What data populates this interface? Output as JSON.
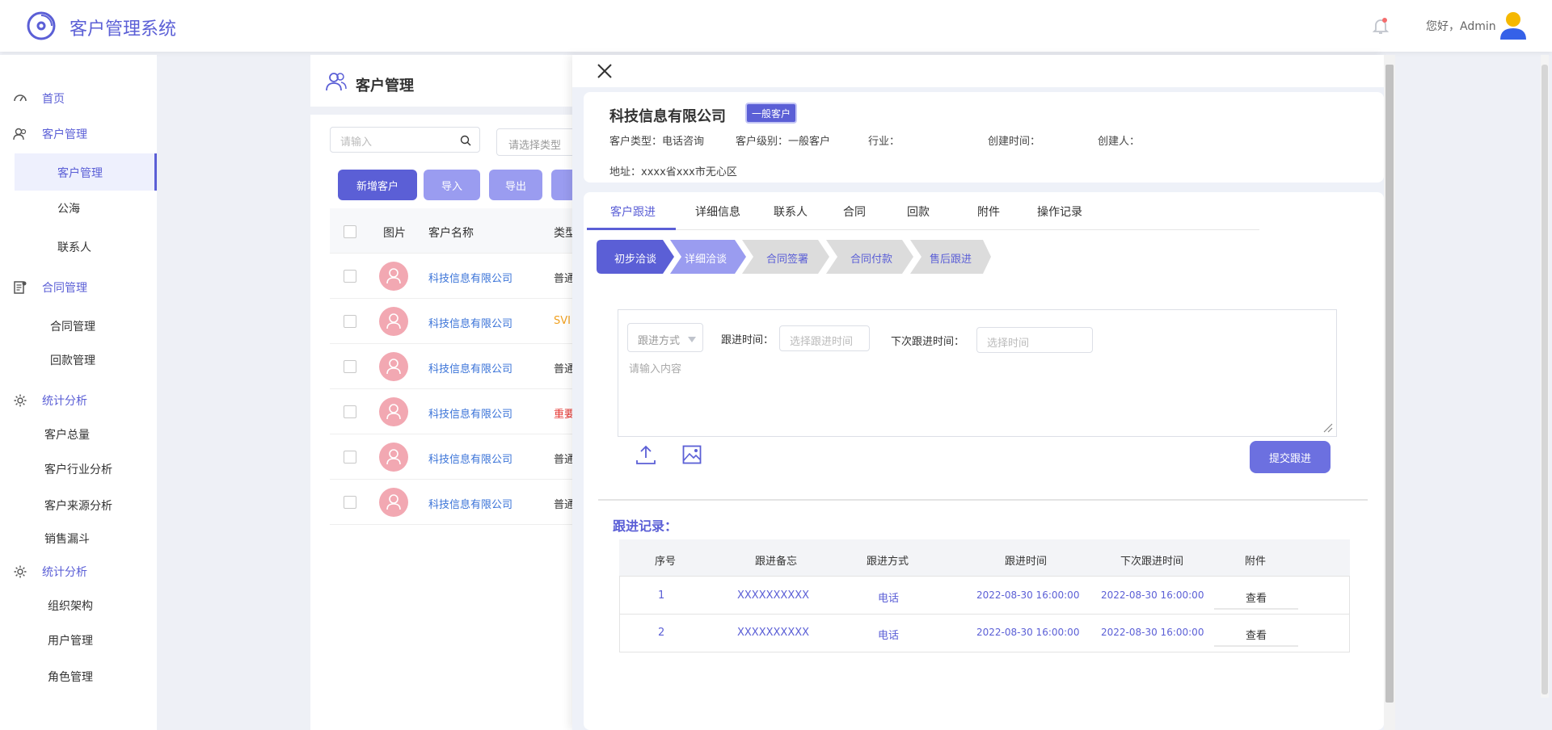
{
  "app": {
    "title": "客户管理系统",
    "greeting": "您好，Admin"
  },
  "colors": {
    "primary": "#5b5fd6",
    "accent_light": "#9a9cf0",
    "link": "#3a73d8",
    "orange": "#f0a020",
    "red": "#e53935"
  },
  "sidebar": {
    "home": "首页",
    "customers": {
      "label": "客户管理",
      "items": [
        "客户管理",
        "公海",
        "联系人"
      ]
    },
    "contracts": {
      "label": "合同管理",
      "items": [
        "合同管理",
        "回款管理"
      ]
    },
    "stats": {
      "label": "统计分析",
      "items": [
        "客户总量",
        "客户行业分析",
        "客户来源分析",
        "销售漏斗"
      ]
    },
    "system": {
      "label": "统计分析",
      "items": [
        "组织架构",
        "用户管理",
        "角色管理"
      ]
    }
  },
  "list": {
    "title": "客户管理",
    "search_placeholder": "请输入",
    "type_placeholder": "请选择类型",
    "buttons": {
      "add": "新增客户",
      "import": "导入",
      "export": "导出"
    },
    "columns": {
      "image": "图片",
      "name": "客户名称",
      "type": "类型"
    },
    "rows": [
      {
        "name": "科技信息有限公司",
        "type": "普通"
      },
      {
        "name": "科技信息有限公司",
        "type": "SVI"
      },
      {
        "name": "科技信息有限公司",
        "type": "普通"
      },
      {
        "name": "科技信息有限公司",
        "type": "重要"
      },
      {
        "name": "科技信息有限公司",
        "type": "普通"
      },
      {
        "name": "科技信息有限公司",
        "type": "普通"
      }
    ]
  },
  "detail": {
    "company": "科技信息有限公司",
    "tag": "一般客户",
    "info": {
      "type": "客户类型：电话咨询",
      "level": "客户级别：一般客户",
      "industry": "行业：",
      "created": "创建时间：",
      "creator": "创建人：",
      "address": "地址：xxxx省xxx市无心区"
    },
    "tabs": [
      "客户跟进",
      "详细信息",
      "联系人",
      "合同",
      "回款",
      "附件",
      "操作记录"
    ],
    "steps": [
      "初步洽谈",
      "详细洽谈",
      "合同签署",
      "合同付款",
      "售后跟进"
    ],
    "form": {
      "method_placeholder": "跟进方式",
      "time_label": "跟进时间：",
      "time_placeholder": "选择跟进时间",
      "next_label": "下次跟进时间：",
      "next_placeholder": "选择时间",
      "content_placeholder": "请输入内容",
      "submit": "提交跟进"
    },
    "records": {
      "title": "跟进记录：",
      "columns": [
        "序号",
        "跟进备忘",
        "跟进方式",
        "跟进时间",
        "下次跟进时间",
        "附件"
      ],
      "rows": [
        {
          "no": "1",
          "memo": "XXXXXXXXXX",
          "method": "电话",
          "time": "2022-08-30  16:00:00",
          "next": "2022-08-30  16:00:00",
          "attach": "查看"
        },
        {
          "no": "2",
          "memo": "XXXXXXXXXX",
          "method": "电话",
          "time": "2022-08-30  16:00:00",
          "next": "2022-08-30  16:00:00",
          "attach": "查看"
        }
      ]
    }
  }
}
